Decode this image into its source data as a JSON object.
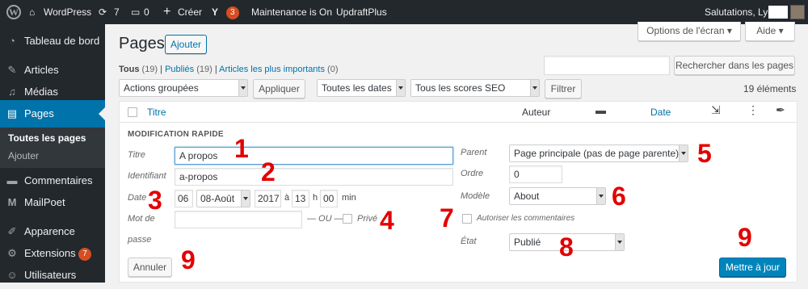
{
  "adminbar": {
    "site_name": "WordPress",
    "updates_count": "7",
    "comments_count": "0",
    "new_label": "Créer",
    "yoast_badge": "3",
    "maintenance": "Maintenance is On",
    "updraft": "UpdraftPlus",
    "greeting": "Salutations, Lyc"
  },
  "sidebar": {
    "dashboard": "Tableau de bord",
    "posts": "Articles",
    "media": "Médias",
    "pages": "Pages",
    "sub_all": "Toutes les pages",
    "sub_add": "Ajouter",
    "comments": "Commentaires",
    "mailpoet": "MailPoet",
    "appearance": "Apparence",
    "extensions": "Extensions",
    "extensions_badge": "7",
    "users": "Utilisateurs"
  },
  "screen_options": "Options de l'écran",
  "help": "Aide",
  "page_title": "Pages",
  "add_new": "Ajouter",
  "filters": {
    "all": "Tous",
    "all_count": "(19)",
    "published": "Publiés",
    "published_count": "(19)",
    "important": "Articles les plus importants",
    "important_count": "(0)"
  },
  "search_button": "Rechercher dans les pages",
  "bulk_actions": "Actions groupées",
  "apply": "Appliquer",
  "all_dates": "Toutes les dates",
  "seo_scores": "Tous les scores SEO",
  "filter_button": "Filtrer",
  "items_count": "19 éléments",
  "table": {
    "title": "Titre",
    "author": "Auteur",
    "date": "Date"
  },
  "quick_edit": {
    "heading": "MODIFICATION RAPIDE",
    "title_label": "Titre",
    "title_value": "A propos",
    "slug_label": "Identifiant",
    "slug_value": "a-propos",
    "date_label": "Date",
    "day": "06",
    "month": "08-Août",
    "year": "2017",
    "at": "à",
    "hour": "13",
    "h": "h",
    "minute": "00",
    "min": "min",
    "password_label_1": "Mot de",
    "password_label_2": "passe",
    "or": "— OU —",
    "private": "Privé",
    "parent_label": "Parent",
    "parent_value": "Page principale (pas de page parente)",
    "order_label": "Ordre",
    "order_value": "0",
    "template_label": "Modèle",
    "template_value": "About",
    "allow_comments": "Autoriser les commentaires",
    "status_label": "État",
    "status_value": "Publié",
    "cancel": "Annuler",
    "update": "Mettre à jour"
  },
  "annotations": [
    "1",
    "2",
    "3",
    "4",
    "5",
    "6",
    "7",
    "8",
    "9",
    "9"
  ],
  "colors": {
    "annotation": "#e40000",
    "primary": "#0085ba",
    "adminbar": "#23282d"
  }
}
